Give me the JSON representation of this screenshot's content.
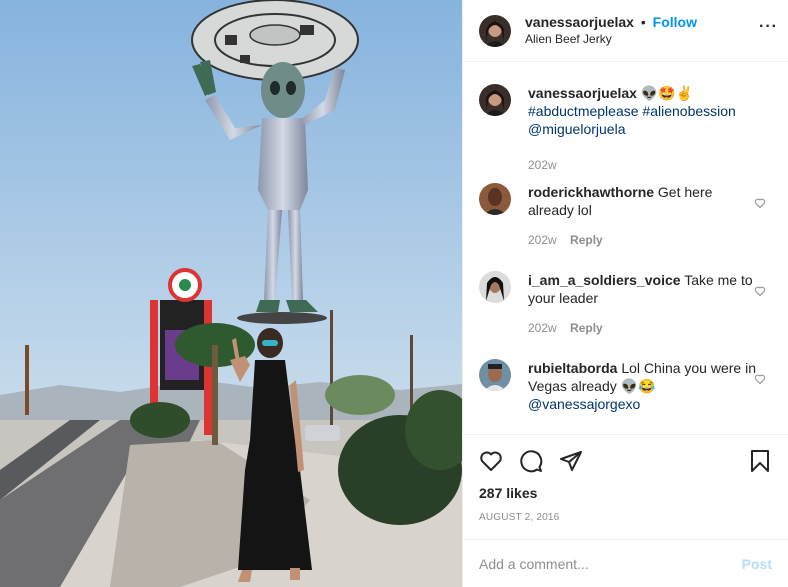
{
  "post": {
    "author": "vanessaorjuelax",
    "separator": "•",
    "follow_label": "Follow",
    "location": "Alien Beef Jerky",
    "more_icon": "more-horizontal-icon"
  },
  "caption": {
    "username": "vanessaorjuelax",
    "emojis": "👽🤩✌",
    "hashtag1": "#abductmeplease",
    "hashtag2": "#alienobession",
    "mention": "@miguelorjuela",
    "time": "202w"
  },
  "comments": [
    {
      "username": "roderickhawthorne",
      "text": "Get here already lol",
      "time": "202w",
      "reply": "Reply"
    },
    {
      "username": "i_am_a_soldiers_voice",
      "text": "Take me to your leader",
      "time": "202w",
      "reply": "Reply"
    },
    {
      "username": "rubieltaborda",
      "text": "Lol China you were in Vegas already 👽😂",
      "mention": "@vanessajorgexo"
    }
  ],
  "actions": {
    "like_icon": "heart-icon",
    "comment_icon": "comment-icon",
    "share_icon": "share-icon",
    "save_icon": "bookmark-icon",
    "likes": "287 likes",
    "date": "AUGUST 2, 2016"
  },
  "add_comment": {
    "placeholder": "Add a comment...",
    "post_label": "Post"
  },
  "colors": {
    "follow": "#0095f6",
    "link": "#00376b",
    "muted": "#8e8e8e",
    "post_disabled": "#b2dffc"
  }
}
